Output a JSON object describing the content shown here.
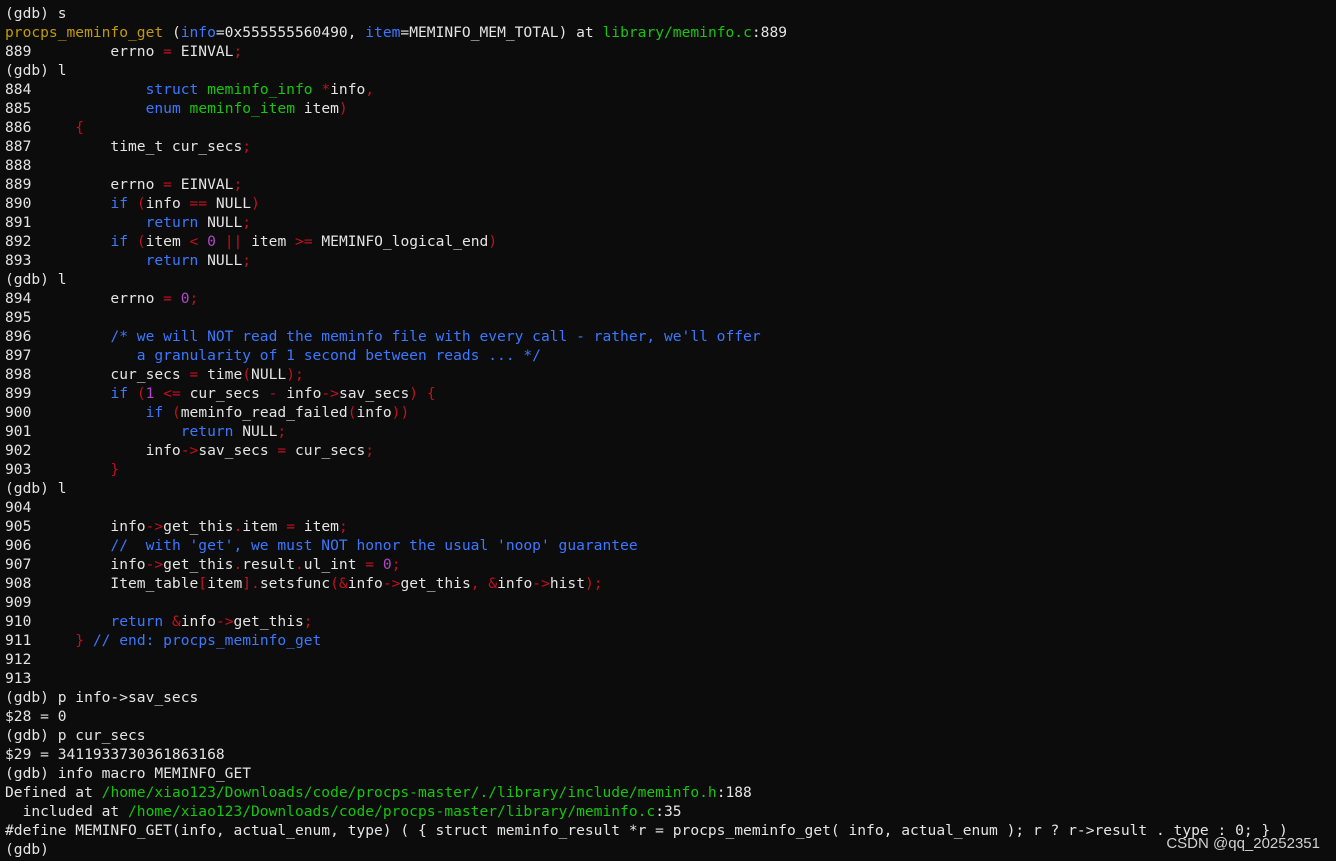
{
  "colors": {
    "background": "#0c0c0c",
    "default": "#e4e4e4",
    "function_name": "#c19c00",
    "param_name": "#3b78ff",
    "keyword": "#3b78ff",
    "type_name": "#16c60c",
    "path": "#16c60c",
    "operator": "#c50f1f",
    "number": "#b148c6",
    "comment": "#3b78ff"
  },
  "terminal": {
    "lines": [
      {
        "segs": [
          {
            "t": "(gdb) s"
          }
        ]
      },
      {
        "segs": [
          {
            "t": "procps_meminfo_get",
            "c": "function_name"
          },
          {
            "t": " ("
          },
          {
            "t": "info",
            "c": "param_name"
          },
          {
            "t": "=0x555555560490, "
          },
          {
            "t": "item",
            "c": "param_name"
          },
          {
            "t": "=MEMINFO_MEM_TOTAL) at "
          },
          {
            "t": "library/meminfo.c",
            "c": "path"
          },
          {
            "t": ":889"
          }
        ]
      },
      {
        "segs": [
          {
            "t": "889         errno "
          },
          {
            "t": "=",
            "c": "operator"
          },
          {
            "t": " EINVAL"
          },
          {
            "t": ";",
            "c": "operator"
          }
        ]
      },
      {
        "segs": [
          {
            "t": "(gdb) l"
          }
        ]
      },
      {
        "segs": [
          {
            "t": "884             "
          },
          {
            "t": "struct",
            "c": "keyword"
          },
          {
            "t": " "
          },
          {
            "t": "meminfo_info",
            "c": "type_name"
          },
          {
            "t": " "
          },
          {
            "t": "*",
            "c": "operator"
          },
          {
            "t": "info"
          },
          {
            "t": ",",
            "c": "operator"
          }
        ]
      },
      {
        "segs": [
          {
            "t": "885             "
          },
          {
            "t": "enum",
            "c": "keyword"
          },
          {
            "t": " "
          },
          {
            "t": "meminfo_item",
            "c": "type_name"
          },
          {
            "t": " item"
          },
          {
            "t": ")",
            "c": "operator"
          }
        ]
      },
      {
        "segs": [
          {
            "t": "886     "
          },
          {
            "t": "{",
            "c": "operator"
          }
        ]
      },
      {
        "segs": [
          {
            "t": "887         time_t cur_secs"
          },
          {
            "t": ";",
            "c": "operator"
          }
        ]
      },
      {
        "segs": [
          {
            "t": "888"
          }
        ]
      },
      {
        "segs": [
          {
            "t": "889         errno "
          },
          {
            "t": "=",
            "c": "operator"
          },
          {
            "t": " EINVAL"
          },
          {
            "t": ";",
            "c": "operator"
          }
        ]
      },
      {
        "segs": [
          {
            "t": "890         "
          },
          {
            "t": "if",
            "c": "keyword"
          },
          {
            "t": " "
          },
          {
            "t": "(",
            "c": "operator"
          },
          {
            "t": "info "
          },
          {
            "t": "==",
            "c": "operator"
          },
          {
            "t": " NULL"
          },
          {
            "t": ")",
            "c": "operator"
          }
        ]
      },
      {
        "segs": [
          {
            "t": "891             "
          },
          {
            "t": "return",
            "c": "keyword"
          },
          {
            "t": " NULL"
          },
          {
            "t": ";",
            "c": "operator"
          }
        ]
      },
      {
        "segs": [
          {
            "t": "892         "
          },
          {
            "t": "if",
            "c": "keyword"
          },
          {
            "t": " "
          },
          {
            "t": "(",
            "c": "operator"
          },
          {
            "t": "item "
          },
          {
            "t": "<",
            "c": "operator"
          },
          {
            "t": " "
          },
          {
            "t": "0",
            "c": "number"
          },
          {
            "t": " "
          },
          {
            "t": "||",
            "c": "operator"
          },
          {
            "t": " item "
          },
          {
            "t": ">=",
            "c": "operator"
          },
          {
            "t": " MEMINFO_logical_end"
          },
          {
            "t": ")",
            "c": "operator"
          }
        ]
      },
      {
        "segs": [
          {
            "t": "893             "
          },
          {
            "t": "return",
            "c": "keyword"
          },
          {
            "t": " NULL"
          },
          {
            "t": ";",
            "c": "operator"
          }
        ]
      },
      {
        "segs": [
          {
            "t": "(gdb) l"
          }
        ]
      },
      {
        "segs": [
          {
            "t": "894         errno "
          },
          {
            "t": "=",
            "c": "operator"
          },
          {
            "t": " "
          },
          {
            "t": "0",
            "c": "number"
          },
          {
            "t": ";",
            "c": "operator"
          }
        ]
      },
      {
        "segs": [
          {
            "t": "895"
          }
        ]
      },
      {
        "segs": [
          {
            "t": "896         "
          },
          {
            "t": "/* we will NOT read the meminfo file with every call - rather, we'll offer",
            "c": "comment"
          }
        ]
      },
      {
        "segs": [
          {
            "t": "897         "
          },
          {
            "t": "   a granularity of 1 second between reads ... */",
            "c": "comment"
          }
        ]
      },
      {
        "segs": [
          {
            "t": "898         cur_secs "
          },
          {
            "t": "=",
            "c": "operator"
          },
          {
            "t": " time"
          },
          {
            "t": "(",
            "c": "operator"
          },
          {
            "t": "NULL"
          },
          {
            "t": ");",
            "c": "operator"
          }
        ]
      },
      {
        "segs": [
          {
            "t": "899         "
          },
          {
            "t": "if",
            "c": "keyword"
          },
          {
            "t": " "
          },
          {
            "t": "(",
            "c": "operator"
          },
          {
            "t": "1",
            "c": "number"
          },
          {
            "t": " "
          },
          {
            "t": "<=",
            "c": "operator"
          },
          {
            "t": " cur_secs "
          },
          {
            "t": "-",
            "c": "operator"
          },
          {
            "t": " info"
          },
          {
            "t": "->",
            "c": "operator"
          },
          {
            "t": "sav_secs"
          },
          {
            "t": ")",
            "c": "operator"
          },
          {
            "t": " "
          },
          {
            "t": "{",
            "c": "operator"
          }
        ]
      },
      {
        "segs": [
          {
            "t": "900             "
          },
          {
            "t": "if",
            "c": "keyword"
          },
          {
            "t": " "
          },
          {
            "t": "(",
            "c": "operator"
          },
          {
            "t": "meminfo_read_failed"
          },
          {
            "t": "(",
            "c": "operator"
          },
          {
            "t": "info"
          },
          {
            "t": "))",
            "c": "operator"
          }
        ]
      },
      {
        "segs": [
          {
            "t": "901                 "
          },
          {
            "t": "return",
            "c": "keyword"
          },
          {
            "t": " NULL"
          },
          {
            "t": ";",
            "c": "operator"
          }
        ]
      },
      {
        "segs": [
          {
            "t": "902             info"
          },
          {
            "t": "->",
            "c": "operator"
          },
          {
            "t": "sav_secs "
          },
          {
            "t": "=",
            "c": "operator"
          },
          {
            "t": " cur_secs"
          },
          {
            "t": ";",
            "c": "operator"
          }
        ]
      },
      {
        "segs": [
          {
            "t": "903         "
          },
          {
            "t": "}",
            "c": "operator"
          }
        ]
      },
      {
        "segs": [
          {
            "t": "(gdb) l"
          }
        ]
      },
      {
        "segs": [
          {
            "t": "904"
          }
        ]
      },
      {
        "segs": [
          {
            "t": "905         info"
          },
          {
            "t": "->",
            "c": "operator"
          },
          {
            "t": "get_this"
          },
          {
            "t": ".",
            "c": "operator"
          },
          {
            "t": "item "
          },
          {
            "t": "=",
            "c": "operator"
          },
          {
            "t": " item"
          },
          {
            "t": ";",
            "c": "operator"
          }
        ]
      },
      {
        "segs": [
          {
            "t": "906         "
          },
          {
            "t": "//  with 'get', we must NOT honor the usual 'noop' guarantee",
            "c": "comment"
          }
        ]
      },
      {
        "segs": [
          {
            "t": "907         info"
          },
          {
            "t": "->",
            "c": "operator"
          },
          {
            "t": "get_this"
          },
          {
            "t": ".",
            "c": "operator"
          },
          {
            "t": "result"
          },
          {
            "t": ".",
            "c": "operator"
          },
          {
            "t": "ul_int "
          },
          {
            "t": "=",
            "c": "operator"
          },
          {
            "t": " "
          },
          {
            "t": "0",
            "c": "number"
          },
          {
            "t": ";",
            "c": "operator"
          }
        ]
      },
      {
        "segs": [
          {
            "t": "908         Item_table"
          },
          {
            "t": "[",
            "c": "operator"
          },
          {
            "t": "item"
          },
          {
            "t": "].",
            "c": "operator"
          },
          {
            "t": "setsfunc"
          },
          {
            "t": "(&",
            "c": "operator"
          },
          {
            "t": "info"
          },
          {
            "t": "->",
            "c": "operator"
          },
          {
            "t": "get_this"
          },
          {
            "t": ",",
            "c": "operator"
          },
          {
            "t": " "
          },
          {
            "t": "&",
            "c": "operator"
          },
          {
            "t": "info"
          },
          {
            "t": "->",
            "c": "operator"
          },
          {
            "t": "hist"
          },
          {
            "t": ");",
            "c": "operator"
          }
        ]
      },
      {
        "segs": [
          {
            "t": "909"
          }
        ]
      },
      {
        "segs": [
          {
            "t": "910         "
          },
          {
            "t": "return",
            "c": "keyword"
          },
          {
            "t": " "
          },
          {
            "t": "&",
            "c": "operator"
          },
          {
            "t": "info"
          },
          {
            "t": "->",
            "c": "operator"
          },
          {
            "t": "get_this"
          },
          {
            "t": ";",
            "c": "operator"
          }
        ]
      },
      {
        "segs": [
          {
            "t": "911     "
          },
          {
            "t": "}",
            "c": "operator"
          },
          {
            "t": " "
          },
          {
            "t": "// end: procps_meminfo_get",
            "c": "comment"
          }
        ]
      },
      {
        "segs": [
          {
            "t": "912"
          }
        ]
      },
      {
        "segs": [
          {
            "t": "913"
          }
        ]
      },
      {
        "segs": [
          {
            "t": "(gdb) p info->sav_secs"
          }
        ]
      },
      {
        "segs": [
          {
            "t": "$28 = 0"
          }
        ]
      },
      {
        "segs": [
          {
            "t": "(gdb) p cur_secs"
          }
        ]
      },
      {
        "segs": [
          {
            "t": "$29 = 3411933730361863168"
          }
        ]
      },
      {
        "segs": [
          {
            "t": "(gdb) info macro MEMINFO_GET"
          }
        ]
      },
      {
        "segs": [
          {
            "t": "Defined at "
          },
          {
            "t": "/home/xiao123/Downloads/code/procps-master/./library/include/meminfo.h",
            "c": "path"
          },
          {
            "t": ":188"
          }
        ]
      },
      {
        "segs": [
          {
            "t": "  included at "
          },
          {
            "t": "/home/xiao123/Downloads/code/procps-master/library/meminfo.c",
            "c": "path"
          },
          {
            "t": ":35"
          }
        ]
      },
      {
        "segs": [
          {
            "t": "#define MEMINFO_GET(info, actual_enum, type) ( { struct meminfo_result *r = procps_meminfo_get( info, actual_enum ); r ? r->result . type : 0; } )"
          }
        ]
      },
      {
        "segs": [
          {
            "t": "(gdb)"
          }
        ]
      }
    ]
  },
  "watermark": {
    "text": "CSDN @qq_20252351"
  }
}
